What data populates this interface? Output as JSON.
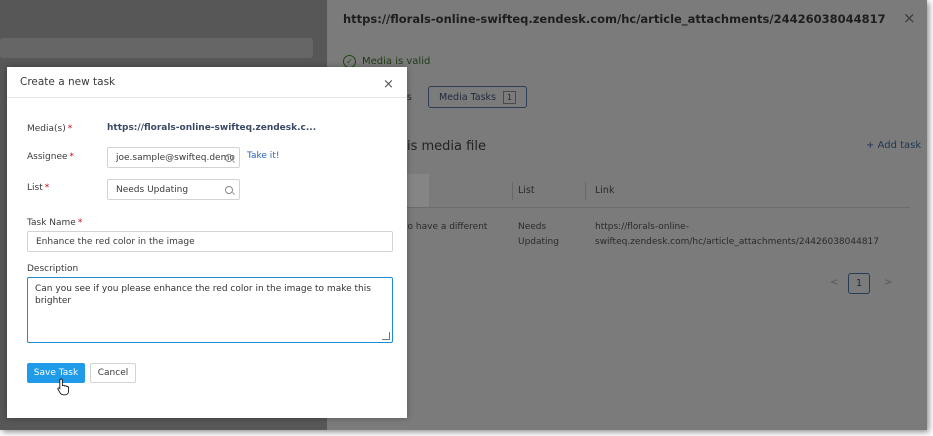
{
  "background_panel": {
    "url": "https://florals-online-swifteq.zendesk.com/hc/article_attachments/24426038044817",
    "close_icon": "×",
    "valid_text": "Media is valid",
    "tabs": [
      {
        "label": "ons"
      },
      {
        "label": "Media Tasks",
        "count": "1"
      }
    ],
    "section_title": "is media file",
    "add_task": "+ Add task",
    "table": {
      "headers": [
        "List",
        "Link"
      ],
      "row": {
        "task": "to have a different",
        "list_line1": "Needs",
        "list_line2": "Updating",
        "link_line1": "https://florals-online-",
        "link_line2": "swifteq.zendesk.com/hc/article_attachments/24426038044817"
      }
    },
    "pager": {
      "prev": "<",
      "page": "1",
      "next": ">"
    }
  },
  "modal": {
    "title": "Create a new task",
    "close_icon": "×",
    "media_label": "Media(s)",
    "media_value": "https://florals-online-swifteq.zendesk.c...",
    "assignee_label": "Assignee",
    "assignee_value": "joe.sample@swifteq.demo",
    "take_it": "Take it!",
    "list_label": "List",
    "list_value": "Needs Updating",
    "task_name_label": "Task Name",
    "task_name_value": "Enhance the red color in the image",
    "description_label": "Description",
    "description_value": "Can you see if you please enhance the red color in the image to make this brighter",
    "required_mark": "*",
    "save_label": "Save Task",
    "cancel_label": "Cancel"
  },
  "colors": {
    "overlay": "#6e6e6e",
    "primary_button": "#1f9be9",
    "link": "#2a66b3",
    "required": "#d0021b"
  },
  "icons": [
    "check-circle-icon",
    "close-icon",
    "search-icon",
    "hand-cursor-icon",
    "chevron-left-icon",
    "chevron-right-icon"
  ]
}
